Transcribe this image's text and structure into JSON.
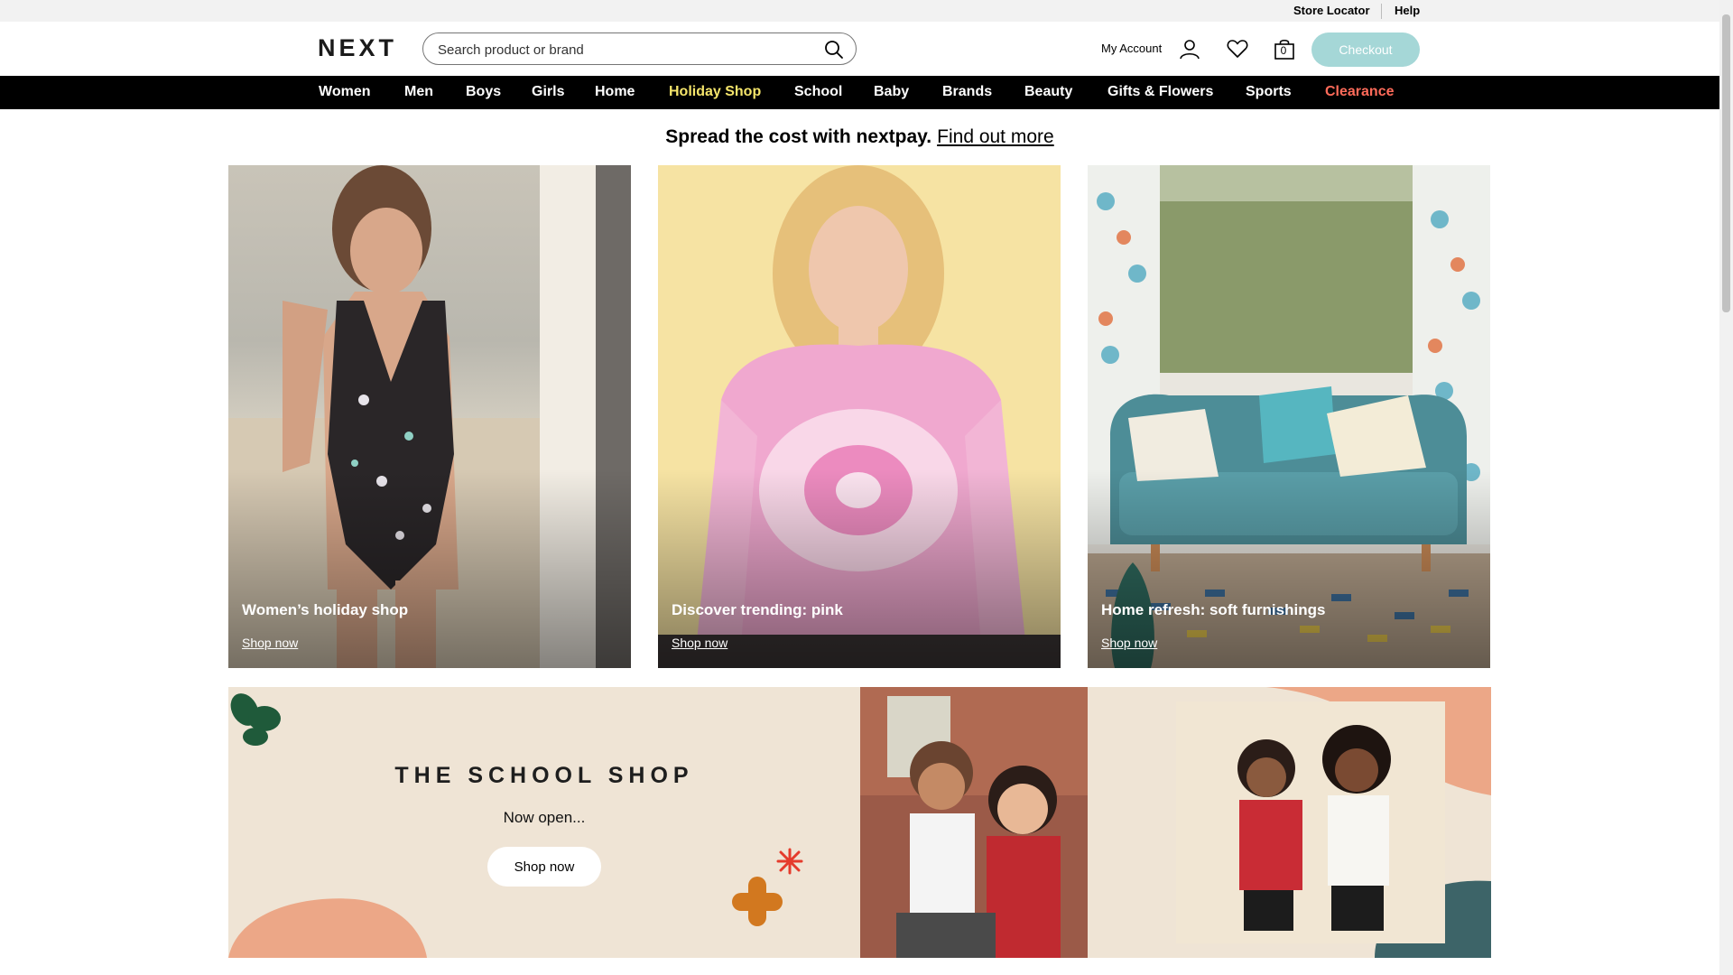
{
  "utility": {
    "store_locator": "Store Locator",
    "help": "Help"
  },
  "header": {
    "logo": "NEXT",
    "search_placeholder": "Search product or brand",
    "account_label": "My Account",
    "bag_count": "0",
    "checkout_label": "Checkout",
    "icons": [
      "search-icon",
      "user-icon",
      "heart-icon",
      "bag-icon"
    ]
  },
  "nav": {
    "items": [
      "Women",
      "Men",
      "Boys",
      "Girls",
      "Home",
      "Holiday Shop",
      "School",
      "Baby",
      "Brands",
      "Beauty",
      "Gifts & Flowers",
      "Sports",
      "Clearance"
    ]
  },
  "promo": {
    "text": "Spread the cost with nextpay.",
    "link": "Find out more"
  },
  "tiles": [
    {
      "caption": "Women’s holiday shop",
      "link": "Shop now"
    },
    {
      "caption": "Discover trending: pink",
      "link": "Shop now"
    },
    {
      "caption": "Home refresh: soft furnishings",
      "link": "Shop now"
    }
  ],
  "school_banner": {
    "title": "THE SCHOOL SHOP",
    "subtitle": "Now open...",
    "button": "Shop now"
  },
  "colors": {
    "nav_bg": "#000000",
    "holiday": "#f5e56b",
    "clearance": "#ff6b5a",
    "checkout": "#a5d7d7",
    "school_bg": "#efe4d5"
  }
}
